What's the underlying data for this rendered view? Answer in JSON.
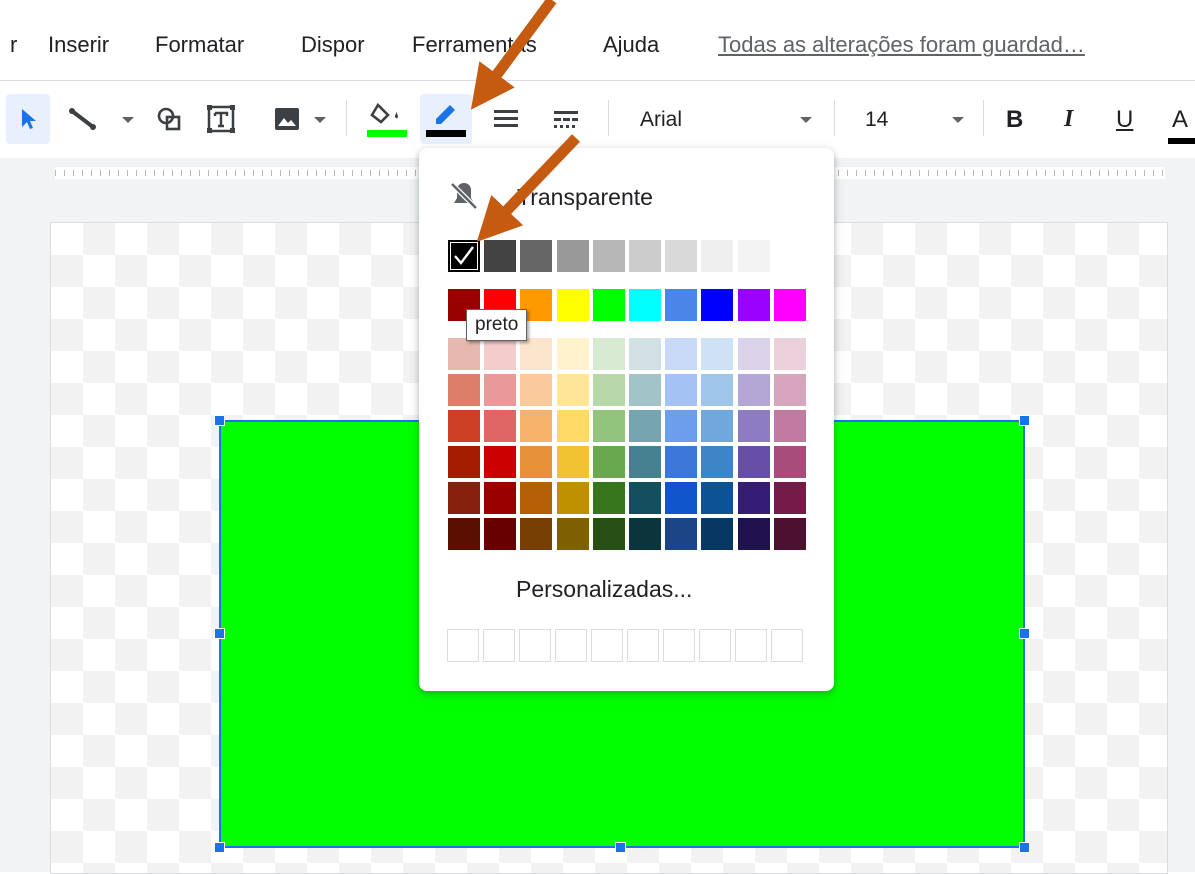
{
  "menu": {
    "items": [
      "r",
      "Inserir",
      "Formatar",
      "Dispor",
      "Ferramentas",
      "Ajuda"
    ],
    "saved_status": "Todas as alterações foram guardad…"
  },
  "toolbar": {
    "icons": [
      "select-icon",
      "line-icon",
      "shape-icon",
      "text-box-icon",
      "image-icon",
      "fill-color-icon",
      "border-color-icon",
      "border-weight-icon",
      "border-dash-icon"
    ],
    "fill_color": "#00ff00",
    "border_color": "#000000",
    "font": "Arial",
    "font_size": "14",
    "format": {
      "bold": "B",
      "italic": "I",
      "underline": "U",
      "text_color": "A"
    }
  },
  "color_popup": {
    "transparent_label": "Transparente",
    "tooltip": "preto",
    "selected": "#000000",
    "grays": [
      "#000000",
      "#434343",
      "#666666",
      "#999999",
      "#b7b7b7",
      "#cccccc",
      "#d9d9d9",
      "#efefef",
      "#f3f3f3",
      "#ffffff"
    ],
    "bright": [
      "#980000",
      "#ff0000",
      "#ff9900",
      "#ffff00",
      "#00ff00",
      "#00ffff",
      "#4a86e8",
      "#0000ff",
      "#9900ff",
      "#ff00ff"
    ],
    "shades": [
      [
        "#e6b8af",
        "#f4cccc",
        "#fce5cd",
        "#fff2cc",
        "#d9ead3",
        "#d0e0e3",
        "#c9daf8",
        "#cfe2f3",
        "#d9d2e9",
        "#ead1dc"
      ],
      [
        "#dd7e6b",
        "#ea9999",
        "#f9cb9c",
        "#ffe599",
        "#b6d7a8",
        "#a2c4c9",
        "#a4c2f4",
        "#9fc5e8",
        "#b4a7d6",
        "#d5a6bd"
      ],
      [
        "#cc4125",
        "#e06666",
        "#f6b26b",
        "#ffd966",
        "#93c47d",
        "#76a5af",
        "#6d9eeb",
        "#6fa8dc",
        "#8e7cc3",
        "#c27ba0"
      ],
      [
        "#a61c00",
        "#cc0000",
        "#e69138",
        "#f1c232",
        "#6aa84f",
        "#45818e",
        "#3c78d8",
        "#3d85c6",
        "#674ea7",
        "#a64d79"
      ],
      [
        "#85200c",
        "#990000",
        "#b45f06",
        "#bf9000",
        "#38761d",
        "#134f5c",
        "#1155cc",
        "#0b5394",
        "#351c75",
        "#741b47"
      ],
      [
        "#5b0f00",
        "#660000",
        "#783f04",
        "#7f6000",
        "#274e13",
        "#0c343d",
        "#1c4587",
        "#073763",
        "#20124d",
        "#4c1130"
      ]
    ],
    "custom_label": "Personalizadas...",
    "custom_slots": 10
  },
  "shape": {
    "fill": "#00ff00",
    "border": "#1a73e8"
  },
  "annotation_color": "#c55a11"
}
